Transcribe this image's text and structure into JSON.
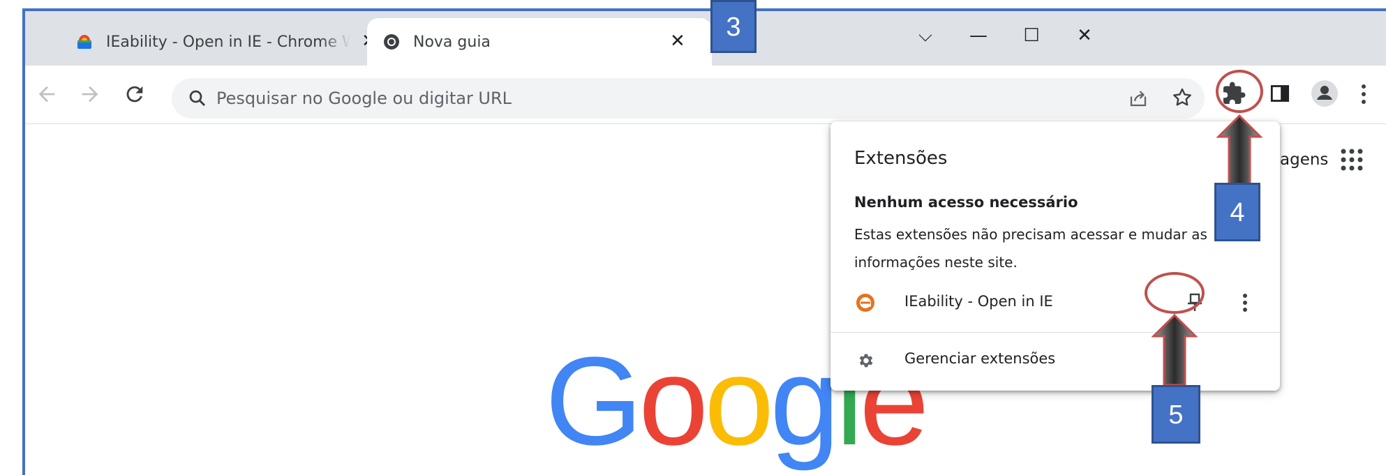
{
  "browser": {
    "tabs": [
      {
        "title": "IEability - Open in IE - Chrome Web Store",
        "favicon": "chrome-web-store-icon",
        "active": false
      },
      {
        "title": "Nova guia",
        "favicon": "chrome-icon",
        "active": true
      }
    ],
    "tab_close_glyph": "✕",
    "window_controls": {
      "tab_search": "⌵",
      "minimize": "—",
      "maximize": "☐",
      "close": "✕"
    },
    "toolbar": {
      "back_icon": "back-arrow-icon",
      "forward_icon": "forward-arrow-icon",
      "reload_icon": "reload-icon",
      "omnibox_placeholder": "Pesquisar no Google ou digitar URL"
    }
  },
  "extensions_popup": {
    "title": "Extensões",
    "section_heading": "Nenhum acesso necessário",
    "section_description": "Estas extensões não precisam acessar e mudar as informações neste site.",
    "items": [
      {
        "name": "IEability - Open in IE",
        "icon": "ie-extension-icon"
      }
    ],
    "manage_label": "Gerenciar extensões"
  },
  "newtab": {
    "images_link": "agens",
    "logo": [
      "G",
      "o",
      "o",
      "g",
      "l",
      "e"
    ]
  },
  "callouts": {
    "step3": "3",
    "step4": "4",
    "step5": "5"
  },
  "colors": {
    "accent_callout": "#4472c4",
    "ring": "#c0504d",
    "google_blue": "#4285f4",
    "google_red": "#ea4335",
    "google_yellow": "#fbbc05",
    "google_green": "#34a853"
  }
}
